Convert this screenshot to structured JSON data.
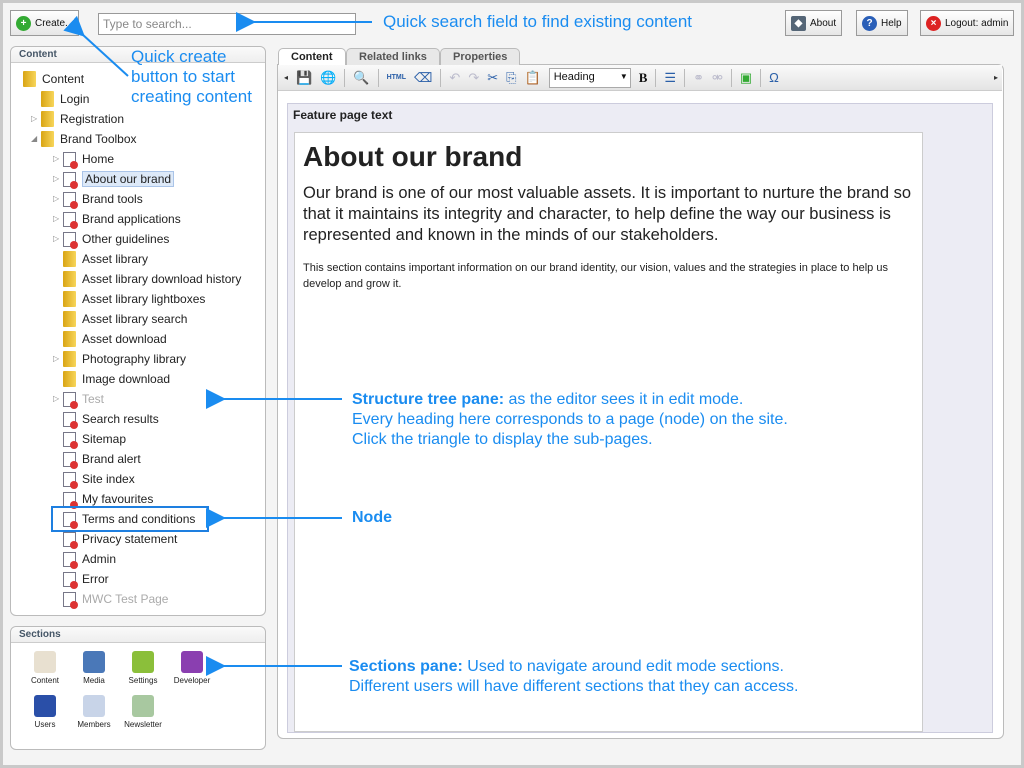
{
  "header": {
    "create_label": "Create...",
    "search_placeholder": "Type to search...",
    "about_label": "About",
    "help_label": "Help",
    "logout_label": "Logout: admin"
  },
  "content_pane": {
    "title": "Content",
    "tree": [
      {
        "label": "Content",
        "type": "folder",
        "level": 0
      },
      {
        "label": "Login",
        "type": "folder",
        "level": 1
      },
      {
        "label": "Registration",
        "type": "folder",
        "level": 1,
        "triangle": "collapsed"
      },
      {
        "label": "Brand Toolbox",
        "type": "folder",
        "level": 1,
        "triangle": "expanded"
      },
      {
        "label": "Home",
        "type": "page",
        "level": 2,
        "triangle": "collapsed"
      },
      {
        "label": "About our brand",
        "type": "page",
        "level": 2,
        "triangle": "collapsed",
        "selected": true
      },
      {
        "label": "Brand tools",
        "type": "page",
        "level": 2,
        "triangle": "collapsed"
      },
      {
        "label": "Brand applications",
        "type": "page",
        "level": 2,
        "triangle": "collapsed"
      },
      {
        "label": "Other guidelines",
        "type": "page",
        "level": 2,
        "triangle": "collapsed"
      },
      {
        "label": "Asset library",
        "type": "folder",
        "level": 2
      },
      {
        "label": "Asset library download history",
        "type": "folder",
        "level": 2
      },
      {
        "label": "Asset library lightboxes",
        "type": "folder",
        "level": 2
      },
      {
        "label": "Asset library search",
        "type": "folder",
        "level": 2
      },
      {
        "label": "Asset download",
        "type": "folder",
        "level": 2
      },
      {
        "label": "Photography library",
        "type": "folder",
        "level": 2,
        "triangle": "collapsed"
      },
      {
        "label": "Image download",
        "type": "folder",
        "level": 2
      },
      {
        "label": "Test",
        "type": "page",
        "level": 2,
        "triangle": "collapsed",
        "muted": true
      },
      {
        "label": "Search results",
        "type": "page",
        "level": 2
      },
      {
        "label": "Sitemap",
        "type": "page",
        "level": 2
      },
      {
        "label": "Brand alert",
        "type": "page",
        "level": 2
      },
      {
        "label": "Site index",
        "type": "page",
        "level": 2
      },
      {
        "label": "My favourites",
        "type": "page",
        "level": 2
      },
      {
        "label": "Terms and conditions",
        "type": "page",
        "level": 2,
        "boxed": true
      },
      {
        "label": "Privacy statement",
        "type": "page",
        "level": 2
      },
      {
        "label": "Admin",
        "type": "page",
        "level": 2
      },
      {
        "label": "Error",
        "type": "page",
        "level": 2
      },
      {
        "label": "MWC Test Page",
        "type": "page",
        "level": 2,
        "muted": true
      }
    ]
  },
  "sections_pane": {
    "title": "Sections",
    "items": [
      {
        "label": "Content",
        "color": "#e8e0d0"
      },
      {
        "label": "Media",
        "color": "#4a78b8"
      },
      {
        "label": "Settings",
        "color": "#8bbf3a"
      },
      {
        "label": "Developer",
        "color": "#8a3fb0"
      },
      {
        "label": "Users",
        "color": "#2a4fa8"
      },
      {
        "label": "Members",
        "color": "#c8d4e8"
      },
      {
        "label": "Newsletter",
        "color": "#a8c8a0"
      }
    ]
  },
  "editor": {
    "tabs": [
      "Content",
      "Related links",
      "Properties"
    ],
    "active_tab": "Content",
    "format_select": "Heading",
    "html_label": "HTML",
    "bold_label": "B",
    "omega_label": "Ω",
    "field_label": "Feature page text",
    "heading": "About our brand",
    "lead": "Our brand is one of our most valuable assets. It is important to nurture the brand so that it maintains its integrity and character, to help define the way our business is represented and known in the minds of our stakeholders.",
    "body": "This section contains important information on our brand identity, our vision, values and the strategies in place to help us develop and grow it."
  },
  "annotations": {
    "search": "Quick search field to find existing content",
    "create": "Quick create button to start creating content",
    "tree_bold": "Structure tree pane:",
    "tree_text": "as the editor sees it in edit mode.",
    "tree_line2": "Every heading here corresponds to a page (node) on the site.",
    "tree_line3": "Click the triangle to display the sub-pages.",
    "node": "Node",
    "sections_bold": "Sections pane:",
    "sections_text": "Used to navigate around edit mode sections.",
    "sections_line2": "Different users will have different sections that they can access.",
    "color": "#1a8cf0"
  }
}
